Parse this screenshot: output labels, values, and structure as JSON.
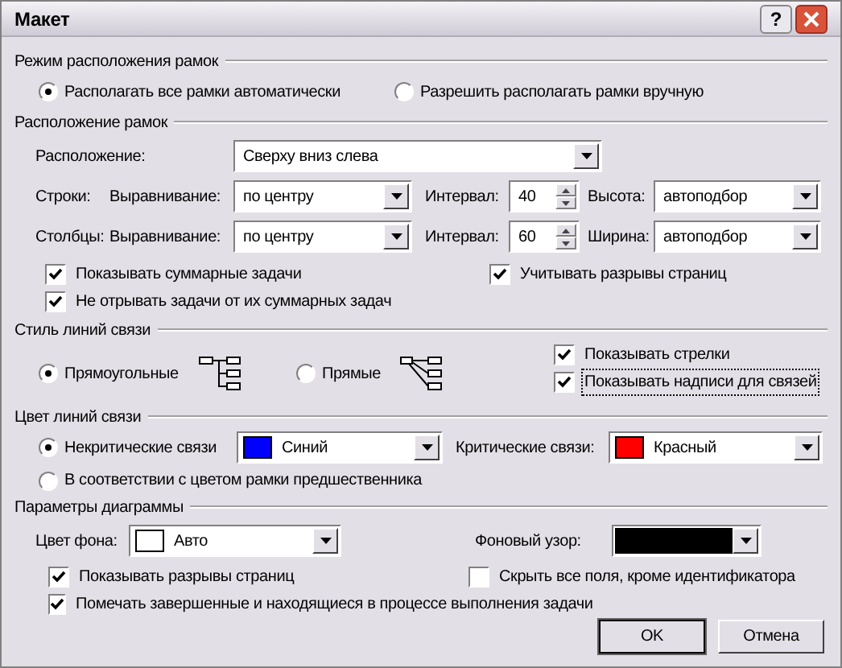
{
  "window": {
    "title": "Макет",
    "help": "?"
  },
  "layout_mode": {
    "title": "Режим расположения рамок",
    "options": [
      {
        "label": "Располагать все рамки автоматически",
        "selected": true
      },
      {
        "label": "Разрешить располагать рамки вручную",
        "selected": false
      }
    ]
  },
  "box_layout": {
    "title": "Расположение рамок",
    "arrangement": {
      "label": "Расположение:",
      "value": "Сверху вниз слева"
    },
    "grid": [
      {
        "label": "Строки:",
        "alignment_label": "Выравнивание:",
        "alignment": "по центру",
        "interval_label": "Интервал:",
        "interval": "40",
        "size_label": "Высота:",
        "size": "автоподбор"
      },
      {
        "label": "Столбцы:",
        "alignment_label": "Выравнивание:",
        "alignment": "по центру",
        "interval_label": "Интервал:",
        "interval": "60",
        "size_label": "Ширина:",
        "size": "автоподбор"
      }
    ],
    "left_checks": [
      {
        "label": "Показывать суммарные задачи",
        "checked": true
      },
      {
        "label": "Не отрывать задачи от их суммарных задач",
        "checked": true
      }
    ],
    "right_checks": [
      {
        "label": "Учитывать разрывы страниц",
        "checked": true
      }
    ]
  },
  "link_style": {
    "title": "Стиль линий связи",
    "options": [
      {
        "label": "Прямоугольные",
        "selected": true,
        "kind": "rectangular"
      },
      {
        "label": "Прямые",
        "selected": false,
        "kind": "straight"
      }
    ],
    "checks": [
      {
        "label": "Показывать стрелки",
        "checked": true,
        "focused": false
      },
      {
        "label": "Показывать надписи для связей",
        "checked": true,
        "focused": true
      }
    ]
  },
  "link_color": {
    "title": "Цвет линий связи",
    "options": [
      {
        "label": "Некритические связи",
        "selected": true
      },
      {
        "label": "В соответствии с цветом рамки предшественника",
        "selected": false
      }
    ],
    "noncritical": {
      "value": "Синий",
      "color": "#0000ff"
    },
    "critical": {
      "label": "Критические связи:",
      "value": "Красный",
      "color": "#ff0000"
    }
  },
  "diagram": {
    "title": "Параметры диаграммы",
    "background": {
      "label": "Цвет фона:",
      "value": "Авто",
      "color": "#ffffff"
    },
    "pattern": {
      "label": "Фоновый узор:",
      "color": "#000000"
    },
    "left_checks": [
      {
        "label": "Показывать разрывы страниц",
        "checked": true
      },
      {
        "label": "Помечать завершенные и находящиеся в процессе выполнения задачи",
        "checked": true
      }
    ],
    "right_checks": [
      {
        "label": "Скрыть все поля, кроме идентификатора",
        "checked": false
      }
    ]
  },
  "buttons": [
    {
      "label": "OK",
      "default": true
    },
    {
      "label": "Отмена",
      "default": false
    }
  ]
}
